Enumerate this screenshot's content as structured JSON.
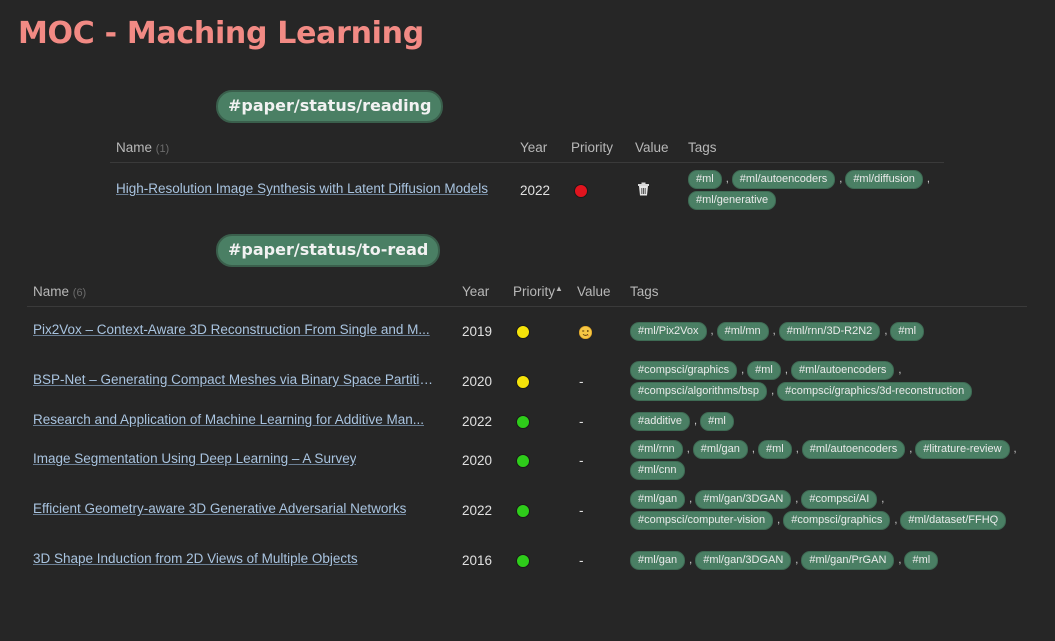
{
  "page": {
    "title": "MOC - Maching Learning"
  },
  "colors": {
    "title": "#f28a84",
    "tag_bg": "#4a7f64",
    "priority_red": "#e0141e",
    "priority_yellow": "#f5e30a",
    "priority_green": "#2ecc1a",
    "link": "#a9c4e0"
  },
  "reading": {
    "section_tag": "#paper/status/reading",
    "headers": {
      "name": "Name",
      "count": "(1)",
      "year": "Year",
      "priority": "Priority",
      "value": "Value",
      "tags": "Tags"
    },
    "rows": [
      {
        "name": "High-Resolution Image Synthesis with Latent Diffusion Models",
        "year": "2022",
        "priority": "red",
        "value": "trash-icon",
        "tags": [
          "#ml",
          "#ml/autoencoders",
          "#ml/diffusion",
          "#ml/generative"
        ]
      }
    ]
  },
  "to_read": {
    "section_tag": "#paper/status/to-read",
    "headers": {
      "name": "Name",
      "count": "(6)",
      "year": "Year",
      "priority": "Priority",
      "sort_indicator": "▲",
      "value": "Value",
      "tags": "Tags"
    },
    "rows": [
      {
        "name": "Pix2Vox – Context-Aware 3D Reconstruction From Single and M...",
        "year": "2019",
        "priority": "yellow",
        "value": "winking-face-icon",
        "tags": [
          "#ml/Pix2Vox",
          "#ml/mn",
          "#ml/rnn/3D-R2N2",
          "#ml"
        ]
      },
      {
        "name": "BSP-Net – Generating Compact Meshes via Binary Space Partitio...",
        "year": "2020",
        "priority": "yellow",
        "value": "-",
        "tags": [
          "#compsci/graphics",
          "#ml",
          "#ml/autoencoders",
          "#compsci/algorithms/bsp",
          "#compsci/graphics/3d-reconstruction"
        ]
      },
      {
        "name": "Research and Application of Machine Learning for Additive Man...",
        "year": "2022",
        "priority": "green",
        "value": "-",
        "tags": [
          "#additive",
          "#ml"
        ]
      },
      {
        "name": "Image Segmentation Using Deep Learning – A Survey",
        "year": "2020",
        "priority": "green",
        "value": "-",
        "tags": [
          "#ml/rnn",
          "#ml/gan",
          "#ml",
          "#ml/autoencoders",
          "#litrature-review",
          "#ml/cnn"
        ]
      },
      {
        "name": "Efficient Geometry-aware 3D Generative Adversarial Networks",
        "year": "2022",
        "priority": "green",
        "value": "-",
        "tags": [
          "#ml/gan",
          "#ml/gan/3DGAN",
          "#compsci/AI",
          "#compsci/computer-vision",
          "#compsci/graphics",
          "#ml/dataset/FFHQ"
        ]
      },
      {
        "name": "3D Shape Induction from 2D Views of Multiple Objects",
        "year": "2016",
        "priority": "green",
        "value": "-",
        "tags": [
          "#ml/gan",
          "#ml/gan/3DGAN",
          "#ml/gan/PrGAN",
          "#ml"
        ]
      }
    ]
  }
}
